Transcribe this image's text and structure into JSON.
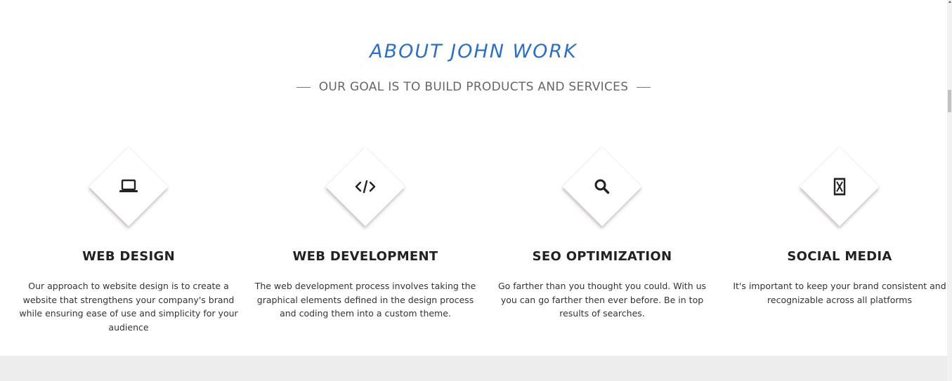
{
  "about": {
    "title": "ABOUT JOHN WORK",
    "subtitle": "OUR GOAL IS TO BUILD PRODUCTS AND SERVICES"
  },
  "services": [
    {
      "icon": "laptop-icon",
      "title": "WEB DESIGN",
      "text": "Our approach to website design is to create a website that strengthens your company's brand while ensuring ease of use and simplicity for your audience"
    },
    {
      "icon": "code-icon",
      "title": "WEB DEVELOPMENT",
      "text": "The web development process involves taking the graphical elements defined in the design process and coding them into a custom theme."
    },
    {
      "icon": "search-icon",
      "title": "SEO OPTIMIZATION",
      "text": "Go farther than you thought you could. With us you can go farther then ever before. Be in top results of searches."
    },
    {
      "icon": "hourglass-icon",
      "title": "SOCIAL MEDIA",
      "text": "It's important to keep your brand consistent and recognizable across all platforms"
    }
  ],
  "colors": {
    "accent": "#2e6fc0",
    "footer_band": "#ededed"
  }
}
